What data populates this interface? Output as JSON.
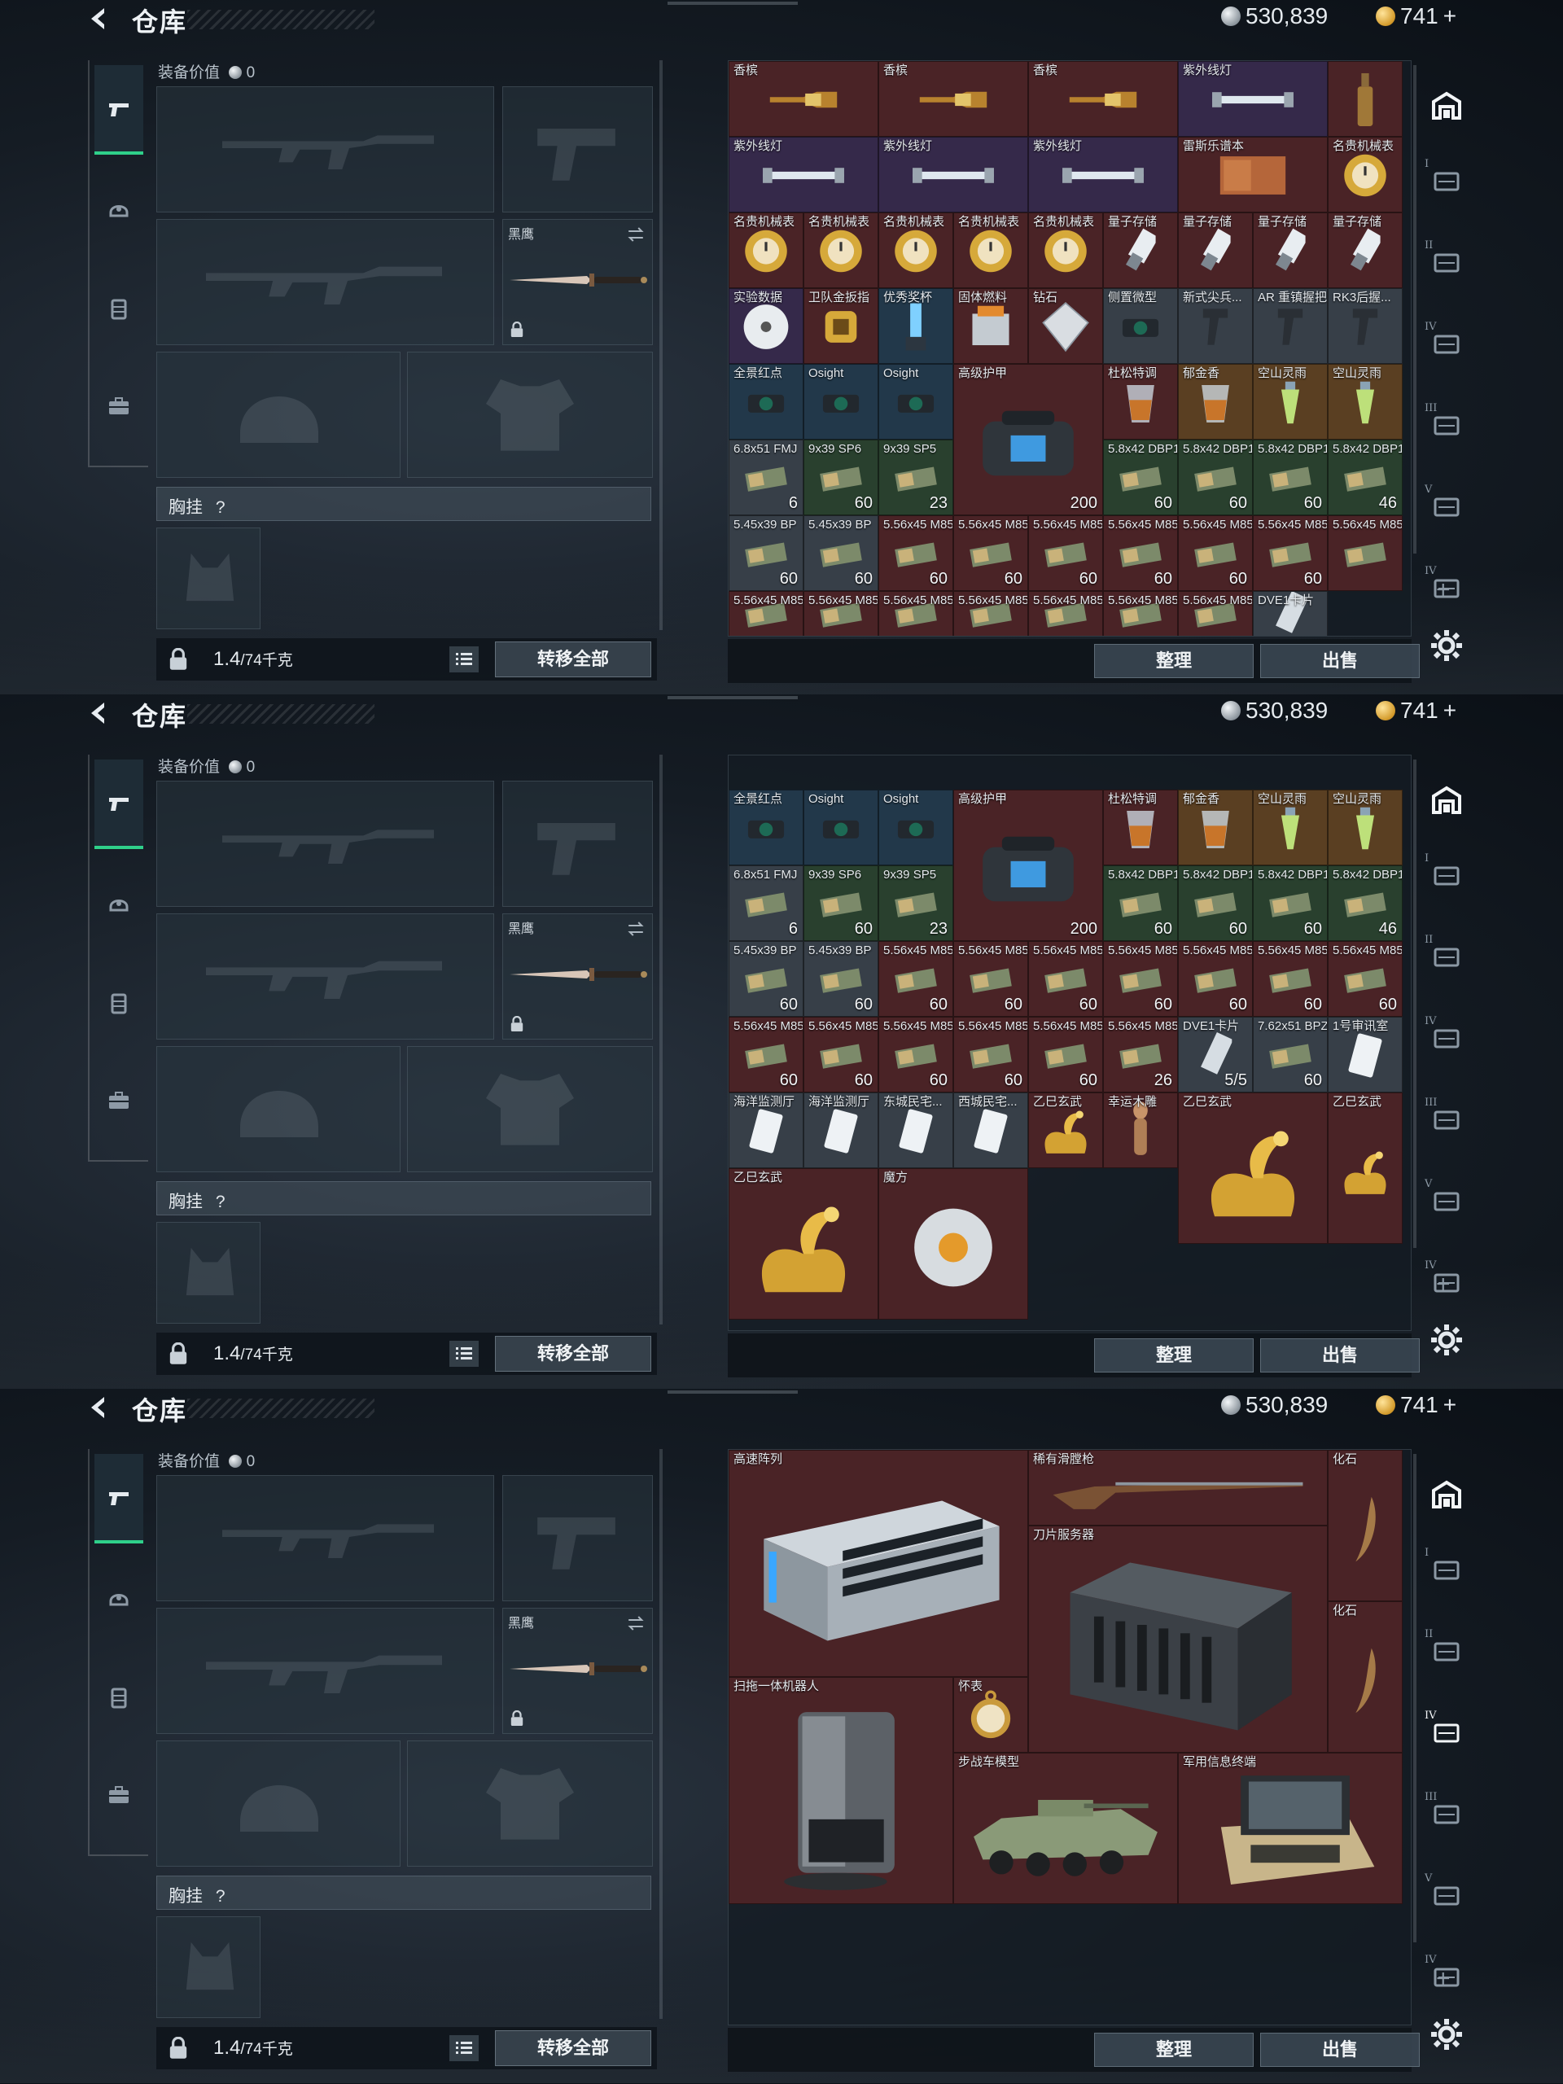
{
  "header": {
    "title": "仓库",
    "silver": "530,839",
    "gold": "741",
    "gold_plus": "+"
  },
  "equipment": {
    "value_label": "装备价值",
    "value": "0",
    "melee_label": "黑鹰",
    "chest_label": "胸挂",
    "chest_help": "?",
    "weight_current": "1.4",
    "weight_max": "/74千克",
    "transfer_all": "转移全部"
  },
  "actions": {
    "sort": "整理",
    "sell": "出售"
  },
  "rail_tabs": [
    "I",
    "II",
    "IV",
    "III",
    "V",
    "IV"
  ],
  "screen1_cells": [
    {
      "name": "香槟",
      "count": "",
      "color": "c-red",
      "icon": "champagne-icon"
    },
    {
      "name": "香槟",
      "count": "",
      "color": "c-red",
      "icon": "champagne-icon"
    },
    {
      "name": "香槟",
      "count": "",
      "color": "c-red",
      "icon": "champagne-icon"
    },
    {
      "name": "紫外线灯",
      "count": "",
      "color": "c-purp",
      "icon": "uv-lamp-icon"
    },
    {
      "name": "",
      "count": "",
      "color": "c-red",
      "icon": "bottle-icon"
    },
    {
      "name": "紫外线灯",
      "count": "",
      "color": "c-purp",
      "icon": "uv-lamp-icon"
    },
    {
      "name": "紫外线灯",
      "count": "",
      "color": "c-purp",
      "icon": "uv-lamp-icon"
    },
    {
      "name": "紫外线灯",
      "count": "",
      "color": "c-purp",
      "icon": "uv-lamp-icon"
    },
    {
      "name": "雷斯乐谱本",
      "count": "",
      "color": "c-red",
      "icon": "book-icon"
    },
    {
      "name": "名贵机械表",
      "count": "",
      "color": "c-red",
      "icon": "watch-icon"
    },
    {
      "name": "名贵机械表",
      "count": "",
      "color": "c-red",
      "icon": "watch-icon"
    },
    {
      "name": "名贵机械表",
      "count": "",
      "color": "c-red",
      "icon": "watch-icon"
    },
    {
      "name": "名贵机械表",
      "count": "",
      "color": "c-red",
      "icon": "watch-icon"
    },
    {
      "name": "名贵机械表",
      "count": "",
      "color": "c-red",
      "icon": "watch-icon"
    },
    {
      "name": "名贵机械表",
      "count": "",
      "color": "c-red",
      "icon": "watch-icon"
    },
    {
      "name": "量子存储",
      "count": "",
      "color": "c-red",
      "icon": "usb-icon"
    },
    {
      "name": "量子存储",
      "count": "",
      "color": "c-red",
      "icon": "usb-icon"
    },
    {
      "name": "量子存储",
      "count": "",
      "color": "c-red",
      "icon": "usb-icon"
    },
    {
      "name": "量子存储",
      "count": "",
      "color": "c-red",
      "icon": "usb-icon"
    },
    {
      "name": "实验数据",
      "count": "",
      "color": "c-purp",
      "icon": "disc-icon"
    },
    {
      "name": "卫队金扳指",
      "count": "",
      "color": "c-red",
      "icon": "ring-icon"
    },
    {
      "name": "优秀奖杯",
      "count": "",
      "color": "c-blue",
      "icon": "trophy-icon"
    },
    {
      "name": "固体燃料",
      "count": "",
      "color": "c-red",
      "icon": "fuel-icon"
    },
    {
      "name": "钻石",
      "count": "",
      "color": "c-red",
      "icon": "diamond-icon"
    },
    {
      "name": "侧置微型",
      "count": "",
      "color": "c-gray",
      "icon": "sight-icon"
    },
    {
      "name": "新式尖兵...",
      "count": "",
      "color": "c-gray",
      "icon": "grip-icon"
    },
    {
      "name": "AR 重镇握把",
      "count": "",
      "color": "c-gray",
      "icon": "grip-icon"
    },
    {
      "name": "RK3后握...",
      "count": "",
      "color": "c-gray",
      "icon": "grip-icon"
    },
    {
      "name": "全景红点",
      "count": "",
      "color": "c-blue",
      "icon": "sight-icon"
    },
    {
      "name": "Osight",
      "count": "",
      "color": "c-blue",
      "icon": "sight-icon"
    },
    {
      "name": "Osight",
      "count": "",
      "color": "c-blue",
      "icon": "sight-icon"
    },
    {
      "name": "高级护甲",
      "count": "200",
      "color": "c-red",
      "icon": "armor-bag-icon"
    },
    {
      "name": "杜松特调",
      "count": "",
      "color": "c-red",
      "icon": "drink-icon"
    },
    {
      "name": "郁金香",
      "count": "",
      "color": "c-gold",
      "icon": "drink-icon"
    },
    {
      "name": "空山灵雨",
      "count": "",
      "color": "c-gold",
      "icon": "vial-icon"
    },
    {
      "name": "空山灵雨",
      "count": "",
      "color": "c-gold",
      "icon": "vial-icon"
    },
    {
      "name": "6.8x51 FMJ",
      "count": "6",
      "color": "c-gray",
      "icon": "ammo-box-icon"
    },
    {
      "name": "9x39 SP6",
      "count": "60",
      "color": "c-green",
      "icon": "ammo-box-icon"
    },
    {
      "name": "9x39 SP5",
      "count": "23",
      "color": "c-green",
      "icon": "ammo-box-icon"
    },
    {
      "name": "5.8x42 DBP10",
      "count": "60",
      "color": "c-green",
      "icon": "ammo-box-icon"
    },
    {
      "name": "5.8x42 DBP10",
      "count": "60",
      "color": "c-green",
      "icon": "ammo-box-icon"
    },
    {
      "name": "5.8x42 DBP10",
      "count": "60",
      "color": "c-green",
      "icon": "ammo-box-icon"
    },
    {
      "name": "5.8x42 DBP10",
      "count": "46",
      "color": "c-green",
      "icon": "ammo-box-icon"
    },
    {
      "name": "5.45x39 BP",
      "count": "60",
      "color": "c-gray",
      "icon": "ammo-box-icon"
    },
    {
      "name": "5.45x39 BP",
      "count": "60",
      "color": "c-gray",
      "icon": "ammo-box-icon"
    },
    {
      "name": "5.56x45 M855A1",
      "count": "60",
      "color": "c-red",
      "icon": "ammo-box-icon"
    },
    {
      "name": "5.56x45 M855A1",
      "count": "60",
      "color": "c-red",
      "icon": "ammo-box-icon"
    },
    {
      "name": "5.56x45 M855A1",
      "count": "60",
      "color": "c-red",
      "icon": "ammo-box-icon"
    },
    {
      "name": "5.56x45 M855A1",
      "count": "60",
      "color": "c-red",
      "icon": "ammo-box-icon"
    },
    {
      "name": "5.56x45 M855A1",
      "count": "60",
      "color": "c-red",
      "icon": "ammo-box-icon"
    },
    {
      "name": "5.56x45 M855A1",
      "count": "60",
      "color": "c-red",
      "icon": "ammo-box-icon"
    },
    {
      "name": "5.56x45 M855A1",
      "count": "",
      "color": "c-red",
      "icon": "ammo-box-icon"
    },
    {
      "name": "5.56x45 M855A1",
      "count": "",
      "color": "c-red",
      "icon": "ammo-box-icon"
    },
    {
      "name": "5.56x45 M855A1",
      "count": "",
      "color": "c-red",
      "icon": "ammo-box-icon"
    },
    {
      "name": "5.56x45 M855A1",
      "count": "",
      "color": "c-red",
      "icon": "ammo-box-icon"
    },
    {
      "name": "5.56x45 M855A1",
      "count": "",
      "color": "c-red",
      "icon": "ammo-box-icon"
    },
    {
      "name": "5.56x45 M855A1",
      "count": "",
      "color": "c-red",
      "icon": "ammo-box-icon"
    },
    {
      "name": "5.56x45 M855A1",
      "count": "",
      "color": "c-red",
      "icon": "ammo-box-icon"
    },
    {
      "name": "5.56x45 M855A1",
      "count": "",
      "color": "c-red",
      "icon": "ammo-box-icon"
    },
    {
      "name": "DVE1卡片",
      "count": "",
      "color": "c-gray",
      "icon": "card-icon"
    }
  ],
  "screen2_cells": [
    {
      "name": "全景红点",
      "count": "",
      "color": "c-blue",
      "icon": "sight-icon"
    },
    {
      "name": "Osight",
      "count": "",
      "color": "c-blue",
      "icon": "sight-icon"
    },
    {
      "name": "Osight",
      "count": "",
      "color": "c-blue",
      "icon": "sight-icon"
    },
    {
      "name": "高级护甲",
      "count": "200",
      "color": "c-red",
      "icon": "armor-bag-icon"
    },
    {
      "name": "杜松特调",
      "count": "",
      "color": "c-red",
      "icon": "drink-icon"
    },
    {
      "name": "郁金香",
      "count": "",
      "color": "c-gold",
      "icon": "drink-icon"
    },
    {
      "name": "空山灵雨",
      "count": "",
      "color": "c-gold",
      "icon": "vial-icon"
    },
    {
      "name": "空山灵雨",
      "count": "",
      "color": "c-gold",
      "icon": "vial-icon"
    },
    {
      "name": "6.8x51 FMJ",
      "count": "6",
      "color": "c-gray",
      "icon": "ammo-box-icon"
    },
    {
      "name": "9x39 SP6",
      "count": "60",
      "color": "c-green",
      "icon": "ammo-box-icon"
    },
    {
      "name": "9x39 SP5",
      "count": "23",
      "color": "c-green",
      "icon": "ammo-box-icon"
    },
    {
      "name": "5.8x42 DBP10",
      "count": "60",
      "color": "c-green",
      "icon": "ammo-box-icon"
    },
    {
      "name": "5.8x42 DBP10",
      "count": "60",
      "color": "c-green",
      "icon": "ammo-box-icon"
    },
    {
      "name": "5.8x42 DBP10",
      "count": "60",
      "color": "c-green",
      "icon": "ammo-box-icon"
    },
    {
      "name": "5.8x42 DBP10",
      "count": "46",
      "color": "c-green",
      "icon": "ammo-box-icon"
    },
    {
      "name": "5.45x39 BP",
      "count": "60",
      "color": "c-gray",
      "icon": "ammo-box-icon"
    },
    {
      "name": "5.45x39 BP",
      "count": "60",
      "color": "c-gray",
      "icon": "ammo-box-icon"
    },
    {
      "name": "5.56x45 M855A1",
      "count": "60",
      "color": "c-red",
      "icon": "ammo-box-icon"
    },
    {
      "name": "5.56x45 M855A1",
      "count": "60",
      "color": "c-red",
      "icon": "ammo-box-icon"
    },
    {
      "name": "5.56x45 M855A1",
      "count": "60",
      "color": "c-red",
      "icon": "ammo-box-icon"
    },
    {
      "name": "5.56x45 M855A1",
      "count": "60",
      "color": "c-red",
      "icon": "ammo-box-icon"
    },
    {
      "name": "5.56x45 M855A1",
      "count": "60",
      "color": "c-red",
      "icon": "ammo-box-icon"
    },
    {
      "name": "5.56x45 M855A1",
      "count": "60",
      "color": "c-red",
      "icon": "ammo-box-icon"
    },
    {
      "name": "5.56x45 M855A1",
      "count": "60",
      "color": "c-red",
      "icon": "ammo-box-icon"
    },
    {
      "name": "5.56x45 M855A1",
      "count": "60",
      "color": "c-red",
      "icon": "ammo-box-icon"
    },
    {
      "name": "5.56x45 M855A1",
      "count": "60",
      "color": "c-red",
      "icon": "ammo-box-icon"
    },
    {
      "name": "5.56x45 M855A1",
      "count": "60",
      "color": "c-red",
      "icon": "ammo-box-icon"
    },
    {
      "name": "5.56x45 M855A1",
      "count": "60",
      "color": "c-red",
      "icon": "ammo-box-icon"
    },
    {
      "name": "5.56x45 M855A1",
      "count": "60",
      "color": "c-red",
      "icon": "ammo-box-icon"
    },
    {
      "name": "5.56x45 M855A1",
      "count": "26",
      "color": "c-red",
      "icon": "ammo-box-icon"
    },
    {
      "name": "DVE1卡片",
      "count": "5/5",
      "color": "c-gray",
      "icon": "card-icon"
    },
    {
      "name": "7.62x51 BPZ",
      "count": "60",
      "color": "c-gray",
      "icon": "ammo-box-icon"
    },
    {
      "name": "1号审讯室",
      "count": "",
      "color": "c-gray",
      "icon": "keycard-icon"
    },
    {
      "name": "海洋监测厅",
      "count": "",
      "color": "c-gray",
      "icon": "keycard-icon"
    },
    {
      "name": "海洋监测厅",
      "count": "",
      "color": "c-gray",
      "icon": "keycard-icon"
    },
    {
      "name": "东城民宅...",
      "count": "",
      "color": "c-gray",
      "icon": "keycard-icon"
    },
    {
      "name": "西城民宅...",
      "count": "",
      "color": "c-gray",
      "icon": "keycard-icon"
    },
    {
      "name": "乙巳玄武",
      "count": "",
      "color": "c-red",
      "icon": "gold-statue-icon"
    },
    {
      "name": "幸运木雕",
      "count": "",
      "color": "c-red",
      "icon": "wood-statue-icon"
    },
    {
      "name": "乙巳玄武",
      "count": "",
      "color": "c-red",
      "icon": "gold-statue-icon"
    },
    {
      "name": "乙巳玄武",
      "count": "",
      "color": "c-red",
      "icon": "gold-statue-icon"
    },
    {
      "name": "乙巳玄武",
      "count": "",
      "color": "c-red",
      "icon": "gold-statue-icon"
    },
    {
      "name": "魔方",
      "count": "",
      "color": "c-red",
      "icon": "cube-icon"
    }
  ],
  "screen3_cells": [
    {
      "name": "高速阵列",
      "count": "",
      "color": "c-red",
      "icon": "server-array-icon"
    },
    {
      "name": "稀有滑膛枪",
      "count": "",
      "color": "c-red",
      "icon": "musket-icon"
    },
    {
      "name": "化石",
      "count": "",
      "color": "c-red",
      "icon": "fossil-icon"
    },
    {
      "name": "刀片服务器",
      "count": "",
      "color": "c-red",
      "icon": "blade-server-icon"
    },
    {
      "name": "化石",
      "count": "",
      "color": "c-red",
      "icon": "fossil-icon"
    },
    {
      "name": "扫拖一体机器人",
      "count": "",
      "color": "c-red",
      "icon": "robot-vacuum-icon"
    },
    {
      "name": "怀表",
      "count": "",
      "color": "c-red",
      "icon": "pocket-watch-icon"
    },
    {
      "name": "步战车模型",
      "count": "",
      "color": "c-red",
      "icon": "ifv-model-icon"
    },
    {
      "name": "军用信息终端",
      "count": "",
      "color": "c-red",
      "icon": "terminal-icon"
    }
  ]
}
